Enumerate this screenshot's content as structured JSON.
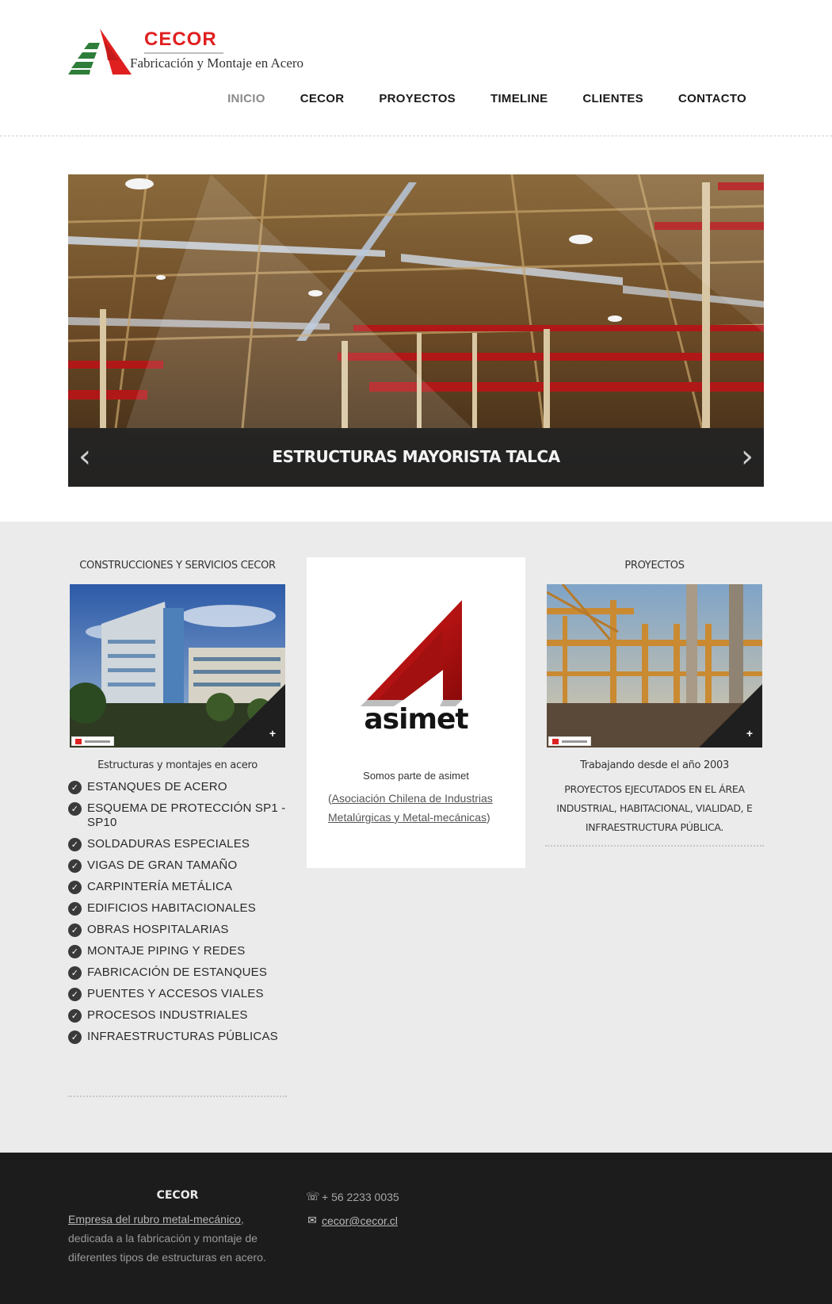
{
  "header": {
    "logo_brand": "CECOR",
    "logo_tagline": "Fabricación y Montaje en Acero",
    "nav": [
      {
        "label": "INICIO",
        "active": true
      },
      {
        "label": "CECOR"
      },
      {
        "label": "PROYECTOS"
      },
      {
        "label": "TIMELINE"
      },
      {
        "label": "CLIENTES"
      },
      {
        "label": "CONTACTO"
      }
    ]
  },
  "slider": {
    "caption": "ESTRUCTURAS MAYORISTA TALCA",
    "prev_glyph": "‹",
    "next_glyph": "›"
  },
  "columns": {
    "left": {
      "title": "CONSTRUCCIONES Y SERVICIOS CECOR",
      "photo_caption": "Estructuras y montajes en acero",
      "services": [
        "ESTANQUES DE ACERO",
        "ESQUEMA DE PROTECCIÓN SP1 - SP10",
        "SOLDADURAS ESPECIALES",
        "VIGAS DE GRAN TAMAÑO",
        "CARPINTERÍA METÁLICA",
        "EDIFICIOS HABITACIONALES",
        "OBRAS HOSPITALARIAS",
        "MONTAJE PIPING Y REDES",
        "FABRICACIÓN DE ESTANQUES",
        "PUENTES Y ACCESOS VIALES",
        "PROCESOS INDUSTRIALES",
        "INFRAESTRUCTURAS PÚBLICAS"
      ]
    },
    "center": {
      "logo_word": "asimet",
      "intro": "Somos parte de asimet",
      "open_paren": "(",
      "link_text": "Asociación Chilena de Industrias Metalúrgicas y Metal-mecánicas",
      "close_paren": ")"
    },
    "right": {
      "title": "PROYECTOS",
      "photo_caption": "Trabajando desde el año 2003",
      "description": "PROYECTOS EJECUTADOS EN EL ÁREA INDUSTRIAL, HABITACIONAL, VIALIDAD, E INFRAESTRUCTURA PÚBLICA."
    }
  },
  "footer": {
    "title": "CECOR",
    "desc_link": "Empresa del rubro metal-mecánico",
    "desc_rest": ", dedicada a la fabricación y montaje de diferentes tipos de estructuras en acero.",
    "phone": "+ 56 2233 0035",
    "email": "cecor@cecor.cl",
    "phone_icon": "phone-icon",
    "email_icon": "email-icon"
  },
  "colors": {
    "brand_red": "#e02020",
    "footer_bg": "#1c1c1c",
    "section_bg": "#ebebeb",
    "caption_bar": "#232323"
  }
}
